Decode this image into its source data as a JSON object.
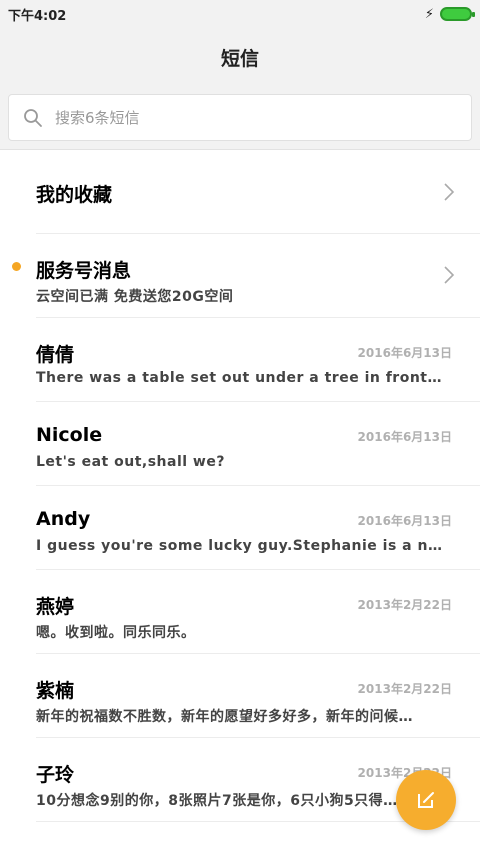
{
  "status": {
    "time": "下午4:02"
  },
  "header": {
    "title": "短信"
  },
  "search": {
    "placeholder": "搜索6条短信"
  },
  "favorites": {
    "label": "我的收藏"
  },
  "service": {
    "title": "服务号消息",
    "subtitle": "云空间已满 免费送您20G空间"
  },
  "messages": [
    {
      "name": "倩倩",
      "date": "2016年6月13日",
      "preview": "There was a table set out under a tree in front…"
    },
    {
      "name": "Nicole",
      "date": "2016年6月13日",
      "preview": "Let's eat out,shall we?"
    },
    {
      "name": "Andy",
      "date": "2016年6月13日",
      "preview": "I guess you're some lucky guy.Stephanie is a nic…"
    },
    {
      "name": "燕婷",
      "date": "2013年2月22日",
      "preview": "嗯。收到啦。同乐同乐。"
    },
    {
      "name": "紫楠",
      "date": "2013年2月22日",
      "preview": "新年的祝福数不胜数，新年的愿望好多好多，新年的问候…"
    },
    {
      "name": "子玲",
      "date": "2013年2月22日",
      "preview": "10分想念9别的你，8张照片7张是你，6只小狗5只得…"
    }
  ],
  "colors": {
    "accent": "#f6ad2e",
    "dot": "#f5a623",
    "battery": "#3fcb3f"
  },
  "icons": {
    "search": "search-icon",
    "chevron": "chevron-right-icon",
    "compose": "compose-icon",
    "bolt": "charging-icon"
  }
}
